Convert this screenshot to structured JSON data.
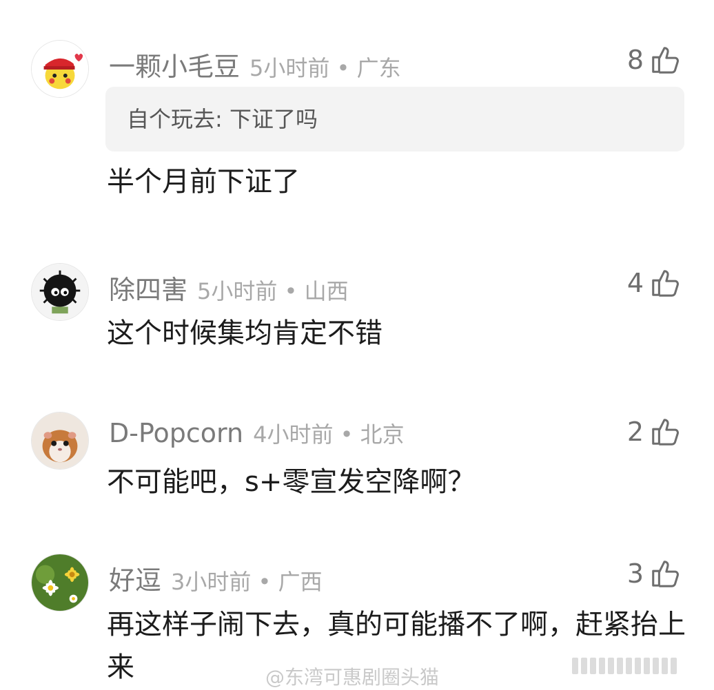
{
  "comments": [
    {
      "name": "一颗小毛豆",
      "time_location": "5小时前 • 广东",
      "likes": "8",
      "reply_quote": "自个玩去: 下证了吗",
      "text": "半个月前下证了",
      "avatar_icon": "pikachu-avatar-icon"
    },
    {
      "name": "除四害",
      "time_location": "5小时前 • 山西",
      "likes": "4",
      "text": "这个时候集均肯定不错",
      "avatar_icon": "soot-sprite-avatar-icon"
    },
    {
      "name": "D-Popcorn",
      "time_location": "4小时前 • 北京",
      "likes": "2",
      "text": "不可能吧，s+零宣发空降啊？",
      "avatar_icon": "hamster-avatar-icon"
    },
    {
      "name": "好逗",
      "time_location": "3小时前 • 广西",
      "likes": "3",
      "text": "再这样子闹下去，真的可能播不了啊，赶紧抬上来",
      "avatar_icon": "daisy-avatar-icon"
    }
  ],
  "watermark": "@东湾可惠剧圈头猫",
  "colors": {
    "name_gray": "#7a7a7a",
    "time_gray": "#a8a8a8",
    "quote_bg": "#f3f3f3"
  }
}
